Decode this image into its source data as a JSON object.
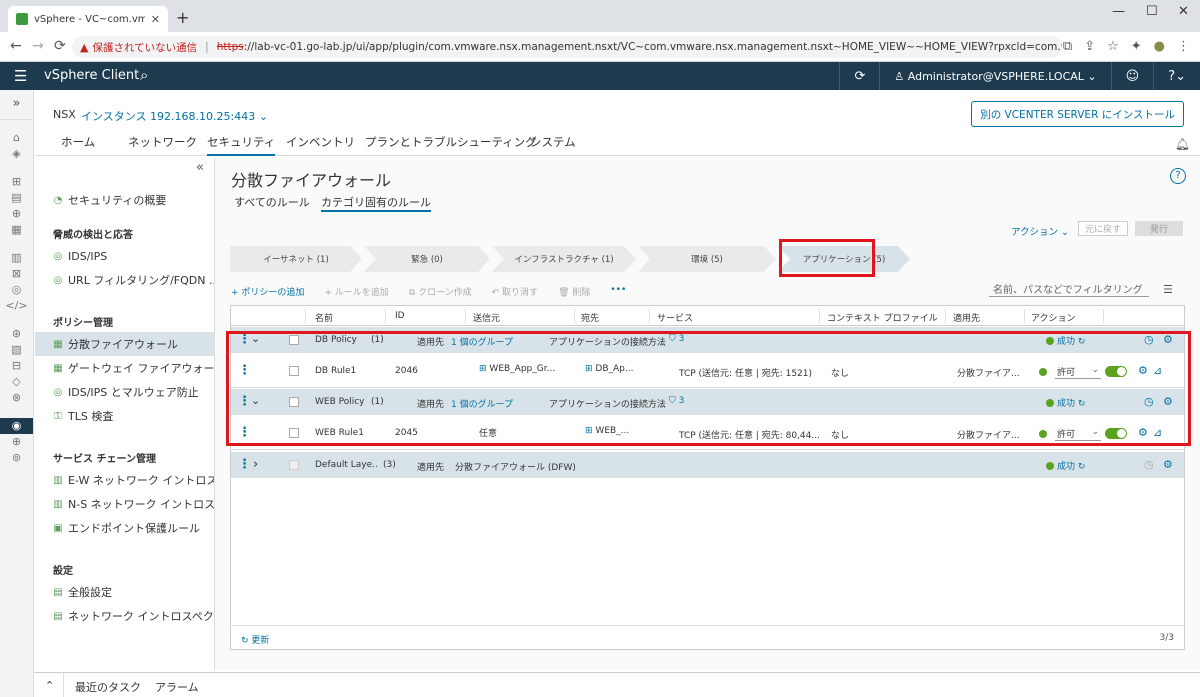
{
  "browser": {
    "tab_title": "vSphere - VC~com.vmware.nsx.m",
    "tab_close": "✕",
    "new_tab": "+",
    "win_min": "—",
    "win_max": "☐",
    "win_close": "✕",
    "nav_back": "←",
    "nav_forward": "→",
    "nav_reload": "⟳",
    "warning_icon": "▲",
    "security_warning": "保護されていない通信",
    "url_separator": "|",
    "url_scheme": "https",
    "url_rest": "://lab-vc-01.go-lab.jp/ui/app/plugin/com.vmware.nsx.management.nsxt/VC~com.vmware.nsx.management.nsxt~HOME_VIEW~~HOME_VIEW?rpxcld=com.vmware.nsx.management.nsxt:3.2.0.1:-5535...",
    "ext_translate": "⧉",
    "ext_share": "⇪",
    "ext_star": "☆",
    "ext_puzzle": "✦",
    "ext_profile": "●",
    "ext_menu": "⋮"
  },
  "vsphere": {
    "menu_icon": "☰",
    "title": "vSphere Client",
    "search_icon": "⌕",
    "refresh_icon": "⟳",
    "user_icon": "♙",
    "user": "Administrator@VSPHERE.LOCAL ⌄",
    "smiley_icon": "☺",
    "help_icon": "?⌄"
  },
  "rail": {
    "expand": "»",
    "icons": [
      "⌂",
      "◈",
      "⊞",
      "▤",
      "⊕",
      "▦",
      "▥",
      "⊠",
      "◎",
      "</>",
      "⊛",
      "▧",
      "⊟",
      "◇",
      "⊗",
      "◉",
      "⊕",
      "⊚"
    ]
  },
  "nsx": {
    "label": "NSX",
    "instance": "インスタンス 192.168.10.25:443 ⌄",
    "install_button": "別の VCENTER SERVER にインストール"
  },
  "mainnav": {
    "items": [
      "ホーム",
      "ネットワーク",
      "セキュリティ",
      "インベントリ",
      "プランとトラブルシューティング",
      "システム"
    ],
    "bell_icon": "🔔︎"
  },
  "sidebar": {
    "collapse": "«",
    "overview": "セキュリティの概要",
    "section_threat": "脅威の検出と応答",
    "ids_ips": "IDS/IPS",
    "url_filter": "URL フィルタリング/FQDN ...",
    "section_policy": "ポリシー管理",
    "dfw": "分散ファイアウォール",
    "gw_fw": "ゲートウェイ ファイアウォール",
    "ids_malware": "IDS/IPS とマルウェア防止",
    "tls": "TLS 検査",
    "section_chain": "サービス チェーン管理",
    "ew": "E-W ネットワーク イントロス...",
    "ns": "N-S ネットワーク イントロス...",
    "endpoint": "エンドポイント保護ルール",
    "section_settings": "設定",
    "general": "全般設定",
    "net_intro": "ネットワーク イントロスペク..."
  },
  "content": {
    "title": "分散ファイアウォール",
    "help": "?",
    "tab_all": "すべてのルール",
    "tab_category": "カテゴリ固有のルール",
    "actions": "アクション ⌄",
    "btn_revert": "元に戻す",
    "btn_publish": "発行",
    "steps": [
      "イーサネット (1)",
      "緊急 (0)",
      "インフラストラクチャ (1)",
      "環境 (5)",
      "アプリケーション (5)"
    ],
    "toolbar": {
      "add_policy": "+ ポリシーの追加",
      "add_rule": "+ ルールを追加",
      "clone": "⧉ クローン作成",
      "undo": "↶ 取り消す",
      "delete": "🗑︎ 削除",
      "more": "•••"
    },
    "filter_placeholder": "名前、パスなどでフィルタリング",
    "filter_icon": "☰"
  },
  "grid": {
    "headers": [
      "名前",
      "ID",
      "送信元",
      "宛先",
      "サービス",
      "コンテキスト プロファイル",
      "適用先",
      "アクション"
    ],
    "dots": "⋮",
    "expand_open": "⌄",
    "expand_closed": "›",
    "apply_label": "適用先",
    "success": "成功",
    "sync_icon": "↻",
    "clock_icon": "◷",
    "gear_icon": "⚙",
    "graph_icon": "⊿",
    "shield_icon": "⛉",
    "group_icon": "⊞",
    "select_caret": "⌄",
    "policies": [
      {
        "name": "DB Policy",
        "count": "(1)",
        "apply": "1 個のグループ",
        "category": "アプリケーションの接続方法",
        "shield": "3",
        "rule": {
          "name": "DB Rule1",
          "id": "2046",
          "source": "WEB_App_Gr...",
          "dest": "DB_Ap...",
          "service": "TCP (送信元: 任意 | 宛先: 1521)",
          "profile": "なし",
          "apply": "分散ファイア...",
          "action": "許可"
        }
      },
      {
        "name": "WEB Policy",
        "count": "(1)",
        "apply": "1 個のグループ",
        "category": "アプリケーションの接続方法",
        "shield": "3",
        "rule": {
          "name": "WEB Rule1",
          "id": "2045",
          "source": "任意",
          "dest": "WEB_...",
          "service": "TCP (送信元: 任意 | 宛先: 80,44...",
          "profile": "なし",
          "apply": "分散ファイア...",
          "action": "許可"
        }
      }
    ],
    "default": {
      "name": "Default Laye...",
      "count": "(3)",
      "apply_value": "分散ファイアウォール (DFW)"
    },
    "refresh": "↻ 更新",
    "pager": "3/3"
  },
  "bottombar": {
    "caret": "⌃",
    "tasks": "最近のタスク",
    "alarms": "アラーム"
  },
  "colors": {
    "header": "#1d3a4f",
    "accent": "#0072a3",
    "success": "#5aa220",
    "highlight": "#e0151d"
  }
}
